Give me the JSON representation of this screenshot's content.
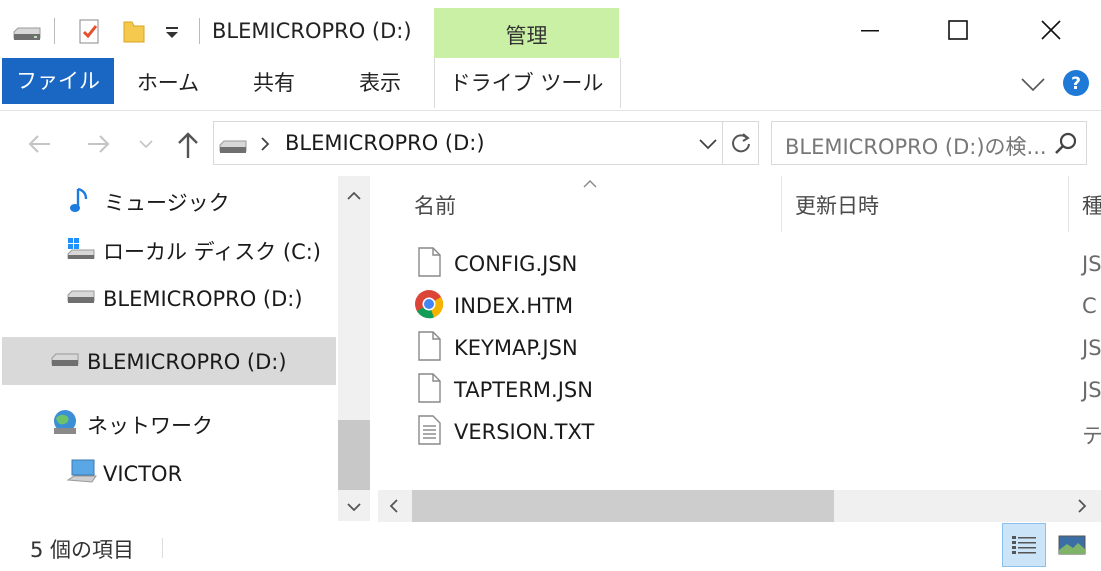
{
  "window": {
    "title": "BLEMICROPRO (D:)",
    "context_tab": "管理",
    "controls": {
      "minimize": "minimize",
      "maximize": "maximize",
      "close": "close"
    }
  },
  "ribbon": {
    "tabs": [
      "ファイル",
      "ホーム",
      "共有",
      "表示",
      "ドライブ ツール"
    ]
  },
  "address": {
    "path": "BLEMICROPRO (D:)",
    "search_placeholder": "BLEMICROPRO (D:)の検..."
  },
  "nav": {
    "items": [
      {
        "label": "ミュージック",
        "icon": "music-icon"
      },
      {
        "label": "ローカル ディスク (C:)",
        "icon": "windows-drive-icon"
      },
      {
        "label": "BLEMICROPRO (D:)",
        "icon": "drive-icon"
      },
      {
        "label": "BLEMICROPRO (D:)",
        "icon": "drive-icon",
        "selected": true
      },
      {
        "label": "ネットワーク",
        "icon": "network-icon"
      },
      {
        "label": "VICTOR",
        "icon": "computer-icon"
      }
    ]
  },
  "columns": {
    "name": "名前",
    "date": "更新日時",
    "type": "種"
  },
  "files": [
    {
      "name": "CONFIG.JSN",
      "type": "JS",
      "icon": "file-icon"
    },
    {
      "name": "INDEX.HTM",
      "type": "C",
      "icon": "chrome-icon"
    },
    {
      "name": "KEYMAP.JSN",
      "type": "JS",
      "icon": "file-icon"
    },
    {
      "name": "TAPTERM.JSN",
      "type": "JS",
      "icon": "file-icon"
    },
    {
      "name": "VERSION.TXT",
      "type": "テ",
      "icon": "text-file-icon"
    }
  ],
  "status": {
    "count": "5 個の項目"
  },
  "colors": {
    "accent": "#1967c3",
    "context_tab": "#c9f0a5",
    "selection": "#d9d9d9"
  }
}
